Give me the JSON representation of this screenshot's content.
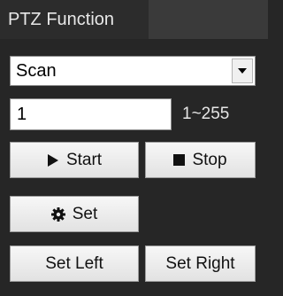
{
  "panel": {
    "title": "PTZ Function"
  },
  "function_select": {
    "selected": "Scan",
    "arrow_icon": "chevron-down-icon"
  },
  "number_field": {
    "value": "1",
    "range_label": "1~255"
  },
  "buttons": {
    "start_label": "Start",
    "start_icon": "play-icon",
    "stop_label": "Stop",
    "stop_icon": "stop-square-icon",
    "set_label": "Set",
    "set_icon": "gear-icon",
    "set_left_label": "Set Left",
    "set_right_label": "Set Right"
  }
}
